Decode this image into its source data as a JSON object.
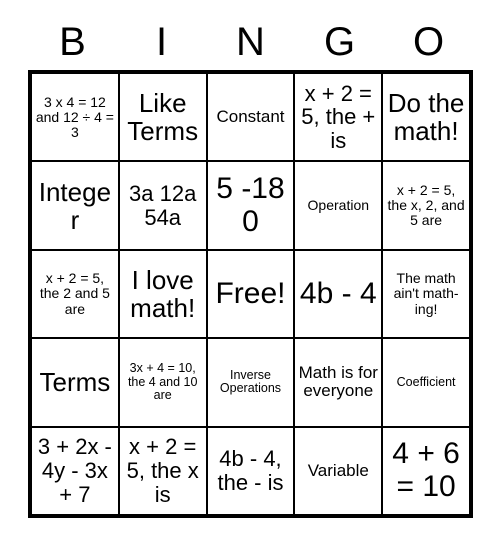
{
  "header": {
    "letters": [
      "B",
      "I",
      "N",
      "G",
      "O"
    ]
  },
  "grid": {
    "columns": 5,
    "rows": 5,
    "free_space_label": "Free!",
    "cells": [
      [
        {
          "text": "3 x 4 = 12 and 12 ÷ 4 = 3",
          "size": "fs-s"
        },
        {
          "text": "Like Terms",
          "size": "fs-xl"
        },
        {
          "text": "Constant",
          "size": "fs-m"
        },
        {
          "text": "x + 2 = 5, the + is",
          "size": "fs-l"
        },
        {
          "text": "Do the math!",
          "size": "fs-xl"
        }
      ],
      [
        {
          "text": "Integer",
          "size": "fs-xl"
        },
        {
          "text": "3a 12a 54a",
          "size": "fs-l"
        },
        {
          "text": "5 -18 0",
          "size": "fs-xxl"
        },
        {
          "text": "Operation",
          "size": "fs-s"
        },
        {
          "text": "x + 2 = 5, the x, 2, and 5 are",
          "size": "fs-s"
        }
      ],
      [
        {
          "text": "x + 2 = 5, the 2 and 5 are",
          "size": "fs-s"
        },
        {
          "text": "I love math!",
          "size": "fs-xl"
        },
        {
          "text": "Free!",
          "size": "fs-xxl"
        },
        {
          "text": "4b - 4",
          "size": "fs-xxl"
        },
        {
          "text": "The math ain't math-ing!",
          "size": "fs-s"
        }
      ],
      [
        {
          "text": "Terms",
          "size": "fs-xl"
        },
        {
          "text": "3x + 4 = 10, the 4 and 10 are",
          "size": "fs-xs"
        },
        {
          "text": "Inverse Operations",
          "size": "fs-xs"
        },
        {
          "text": "Math is for everyone",
          "size": "fs-m"
        },
        {
          "text": "Coefficient",
          "size": "fs-xs"
        }
      ],
      [
        {
          "text": "3 + 2x - 4y - 3x + 7",
          "size": "fs-l"
        },
        {
          "text": "x + 2 = 5, the x is",
          "size": "fs-l"
        },
        {
          "text": "4b - 4, the - is",
          "size": "fs-l"
        },
        {
          "text": "Variable",
          "size": "fs-m"
        },
        {
          "text": "4 + 6 = 10",
          "size": "fs-xxl"
        }
      ]
    ]
  },
  "colors": {
    "background": "#ffffff",
    "border": "#000000",
    "text": "#000000"
  }
}
